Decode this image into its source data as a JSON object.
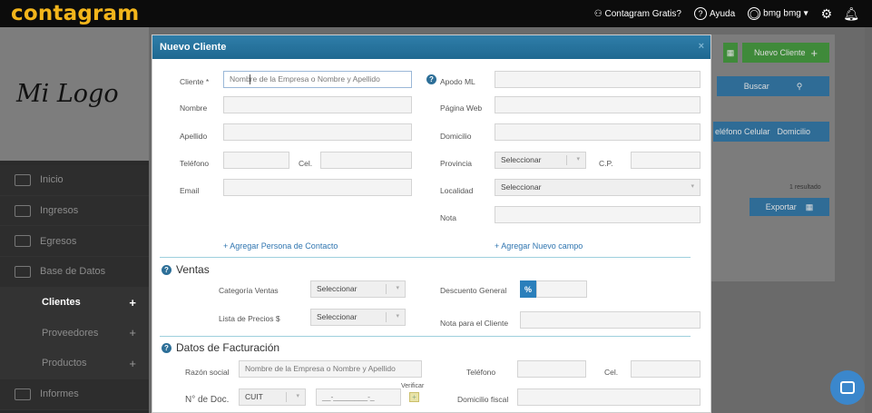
{
  "app": {
    "brand": "contagram",
    "promo": "Contagram Gratis?",
    "help": "Ayuda",
    "user": "bmg bmg"
  },
  "sidebar": {
    "logo": "Mi Logo",
    "items": [
      {
        "label": "Inicio",
        "plus": ""
      },
      {
        "label": "Ingresos",
        "plus": ""
      },
      {
        "label": "Egresos",
        "plus": ""
      },
      {
        "label": "Base de Datos",
        "plus": ""
      },
      {
        "label": "Clientes",
        "plus": "+"
      },
      {
        "label": "Proveedores",
        "plus": "+"
      },
      {
        "label": "Productos",
        "plus": "+"
      },
      {
        "label": "Informes",
        "plus": ""
      }
    ]
  },
  "background": {
    "new_client": "Nuevo Cliente",
    "search": "Buscar",
    "col_phone": "eléfono Celular",
    "col_address": "Domicilio",
    "results": "1 resultado",
    "export": "Exportar"
  },
  "modal": {
    "title": "Nuevo Cliente",
    "close": "×",
    "fields": {
      "cliente": "Cliente *",
      "cliente_ph": "Nombre de la Empresa o Nombre y Apellido",
      "nombre": "Nombre",
      "apellido": "Apellido",
      "telefono": "Teléfono",
      "cel": "Cel.",
      "email": "Email",
      "apodo": "Apodo ML",
      "pagina": "Página Web",
      "domicilio": "Domicilio",
      "provincia": "Provincia",
      "provincia_val": "Seleccionar",
      "cp": "C.P.",
      "localidad": "Localidad",
      "localidad_val": "Seleccionar",
      "nota": "Nota"
    },
    "links": {
      "add_contact": "+ Agregar Persona de Contacto",
      "add_field": "+ Agregar Nuevo campo"
    },
    "ventas": {
      "title": "Ventas",
      "categoria": "Categoría Ventas",
      "categoria_val": "Seleccionar",
      "lista": "Lista de Precios $",
      "lista_val": "Seleccionar",
      "descuento": "Descuento General",
      "pct": "%",
      "nota_cliente": "Nota para el Cliente"
    },
    "facturacion": {
      "title": "Datos de Facturación",
      "razon": "Razón social",
      "razon_ph": "Nombre de la Empresa o Nombre y Apellido",
      "telefono": "Teléfono",
      "cel": "Cel.",
      "doc": "N° de Doc.",
      "doc_type": "CUIT",
      "doc_ph": "__-________-_",
      "verificar": "Verificar",
      "domicilio": "Domicilio fiscal"
    }
  }
}
